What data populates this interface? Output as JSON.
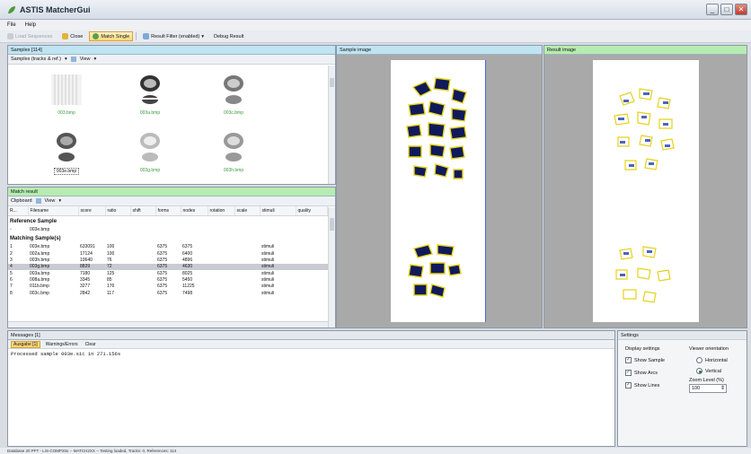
{
  "window": {
    "title": "ASTIS MatcherGui"
  },
  "menu": [
    "File",
    "Help"
  ],
  "toolbar": {
    "load": "Load Sequences",
    "close": "Close",
    "match_single": "Match Single",
    "result_filter": "Result Filter (enabled)",
    "debug_result": "Debug Result"
  },
  "samples": {
    "header": "Samples [114]",
    "dropdown": "Samples (tracks & ref.)",
    "view": "View",
    "thumbs": [
      "003.bmp",
      "003a.bmp",
      "003c.bmp",
      "003e.bmp",
      "003g.bmp",
      "003h.bmp"
    ]
  },
  "match": {
    "header": "Match result",
    "clipboard": "Clipboard",
    "view": "View",
    "columns": [
      "R...",
      "Filename",
      "score",
      "ratio",
      "shift",
      "forms",
      "nodes",
      "rotation",
      "scale",
      "stimuli",
      "quality"
    ],
    "reference_title": "Reference Sample",
    "reference_file": "003e.bmp",
    "matching_title": "Matching Sample(s)",
    "rows": [
      {
        "r": "1",
        "file": "003e.bmp",
        "score": "633091",
        "ratio": "100",
        "forms": "6375",
        "nodes": "6375",
        "stimuli": "stimuli"
      },
      {
        "r": "2",
        "file": "002a.bmp",
        "score": "17124",
        "ratio": "100",
        "forms": "6375",
        "nodes": "6400",
        "stimuli": "stimuli"
      },
      {
        "r": "3",
        "file": "003h.bmp",
        "score": "10640",
        "ratio": "76",
        "forms": "6375",
        "nodes": "4896",
        "stimuli": "stimuli"
      },
      {
        "r": "4",
        "file": "003g.bmp",
        "score": "8839",
        "ratio": "72",
        "forms": "6375",
        "nodes": "4630",
        "stimuli": "stimuli"
      },
      {
        "r": "5",
        "file": "003a.bmp",
        "score": "7180",
        "ratio": "125",
        "forms": "6375",
        "nodes": "8025",
        "stimuli": "stimuli"
      },
      {
        "r": "6",
        "file": "008a.bmp",
        "score": "3345",
        "ratio": "85",
        "forms": "6375",
        "nodes": "5450",
        "stimuli": "stimuli"
      },
      {
        "r": "7",
        "file": "011b.bmp",
        "score": "3277",
        "ratio": "176",
        "forms": "6375",
        "nodes": "11225",
        "stimuli": "stimuli"
      },
      {
        "r": "8",
        "file": "003c.bmp",
        "score": "2842",
        "ratio": "117",
        "forms": "6375",
        "nodes": "7498",
        "stimuli": "stimuli"
      }
    ]
  },
  "sample_image": {
    "header": "Sample image"
  },
  "result_image": {
    "header": "Result image"
  },
  "messages": {
    "header": "Messages [1]",
    "tabs": [
      "Ausgabe [1]",
      "Warnings/Errors",
      "Clear"
    ],
    "lines": [
      "Processed sample 003e.sic in 271.156s"
    ]
  },
  "settings": {
    "header": "Settings",
    "display_settings": "Display settings",
    "viewer_orientation": "Viewer orientation",
    "show_sample": "Show Sample",
    "show_arcs": "Show Arcs",
    "show_lines": "Show Lines",
    "horizontal": "Horizontal",
    "vertical": "Vertical",
    "zoom_label": "Zoom Level (%)",
    "zoom_value": "100"
  },
  "statusbar": {
    "text": "Database 20 PFT - LIS-COMP20x -- MATCH2XX -- Testing loaded, Tracks: 0, References: 114"
  },
  "colors": {
    "sample_header": "#bfe4f2",
    "result_header": "#b6ecb0",
    "active_button": "#fcd77b"
  }
}
